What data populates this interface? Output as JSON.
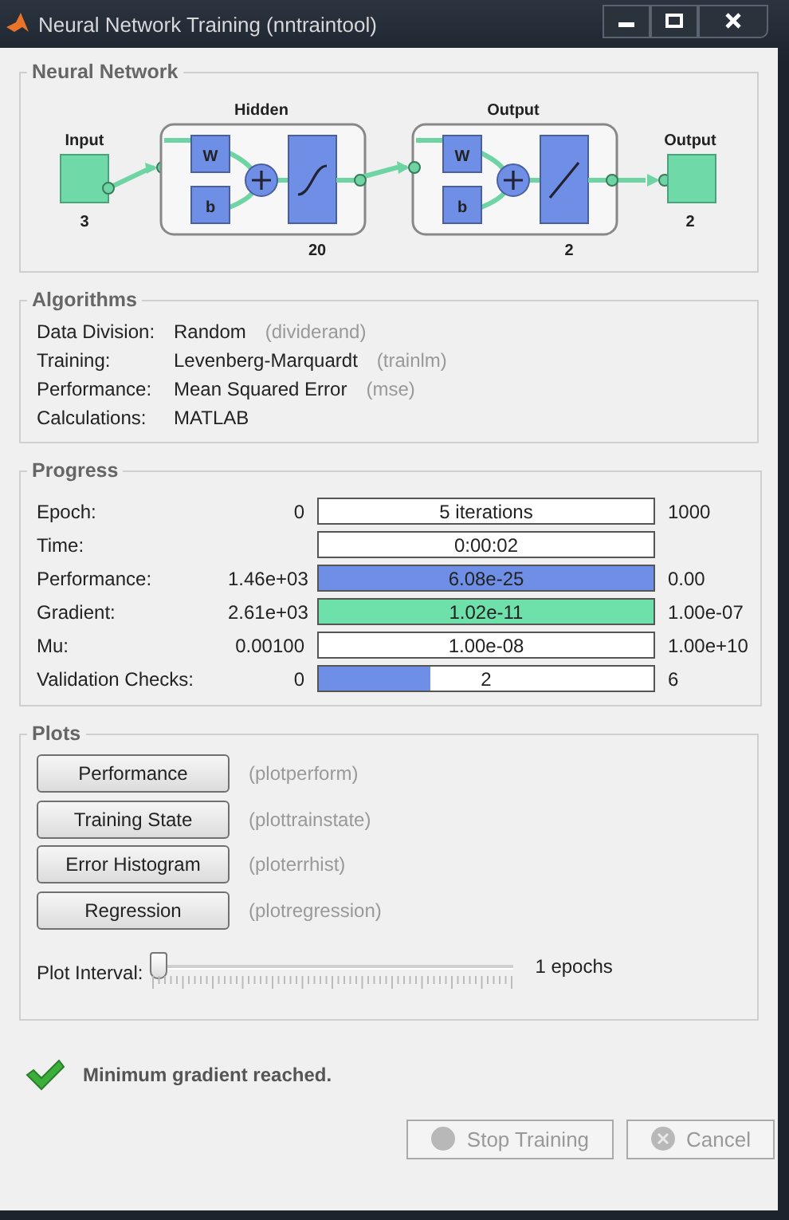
{
  "window": {
    "title": "Neural Network Training (nntraintool)"
  },
  "network": {
    "title": "Neural Network",
    "input": {
      "label": "Input",
      "size": "3"
    },
    "layers": [
      {
        "title": "Hidden",
        "weight": "W",
        "bias": "b",
        "kind": "sigmoid",
        "size": "20"
      },
      {
        "title": "Output",
        "weight": "W",
        "bias": "b",
        "kind": "linear",
        "size": "2"
      }
    ],
    "output": {
      "label": "Output",
      "size": "2"
    }
  },
  "algorithms": {
    "title": "Algorithms",
    "rows": [
      {
        "label": "Data Division:",
        "value": "Random",
        "function": "(dividerand)"
      },
      {
        "label": "Training:",
        "value": "Levenberg-Marquardt",
        "function": "(trainlm)"
      },
      {
        "label": "Performance:",
        "value": "Mean Squared Error",
        "function": "(mse)"
      },
      {
        "label": "Calculations:",
        "value": "MATLAB"
      }
    ]
  },
  "progress": {
    "title": "Progress",
    "rows": [
      {
        "label": "Epoch:",
        "start": "0",
        "reading": "5 iterations",
        "level": 0,
        "end": "1000"
      },
      {
        "label": "Time:",
        "reading": "0:00:02",
        "level": 0
      },
      {
        "label": "Performance:",
        "start": "1.46e+03",
        "reading": "6.08e-25",
        "level": 1,
        "color": "#6f8fe6",
        "end": "0.00"
      },
      {
        "label": "Gradient:",
        "start": "2.61e+03",
        "reading": "1.02e-11",
        "level": 1,
        "color": "#6ee0aa",
        "end": "1.00e-07"
      },
      {
        "label": "Mu:",
        "start": "0.00100",
        "reading": "1.00e-08",
        "level": 0,
        "end": "1.00e+10"
      },
      {
        "label": "Validation Checks:",
        "start": "0",
        "reading": "2",
        "level": 0.333,
        "color": "#6f8fe6",
        "end": "6"
      }
    ]
  },
  "plots": {
    "title": "Plots",
    "buttons": [
      {
        "label": "Performance",
        "function": "(plotperform)"
      },
      {
        "label": "Training State",
        "function": "(plottrainstate)"
      },
      {
        "label": "Error Histogram",
        "function": "(ploterrhist)"
      },
      {
        "label": "Regression",
        "function": "(plotregression)"
      }
    ],
    "interval": {
      "label": "Plot Interval:",
      "level": 0,
      "reading": "1 epochs"
    }
  },
  "status": {
    "message": "Minimum gradient reached."
  },
  "buttons": [
    {
      "label": "Stop Training",
      "kind": "stop",
      "disabled": true
    },
    {
      "label": "Cancel",
      "kind": "cancel",
      "disabled": true
    }
  ]
}
